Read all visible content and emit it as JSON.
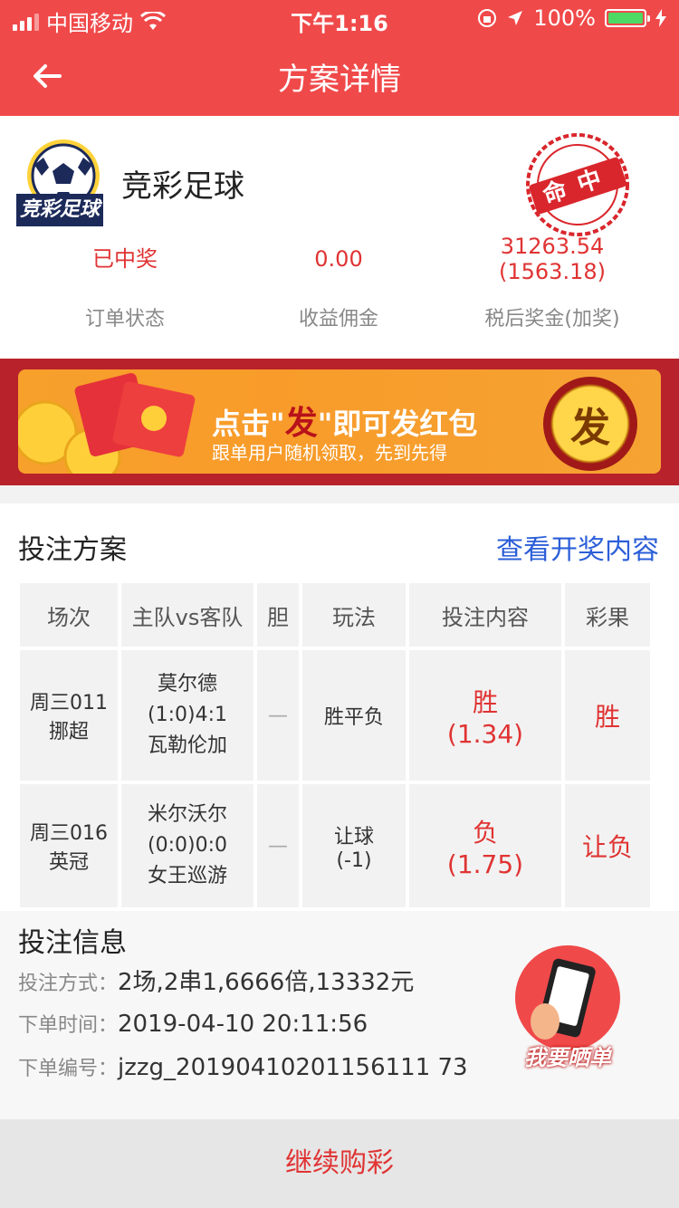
{
  "status_bar": {
    "carrier": "中国移动",
    "time": "下午1:16",
    "battery": "100%"
  },
  "nav": {
    "title": "方案详情"
  },
  "lottery": {
    "name": "竞彩足球",
    "logo_text": "竞彩足球",
    "stamp_text": "命中"
  },
  "stats": [
    {
      "value": "已中奖",
      "label": "订单状态"
    },
    {
      "value": "0.00",
      "label": "收益佣金"
    },
    {
      "value": "31263.54",
      "value2": "(1563.18)",
      "label": "税后奖金(加奖)"
    }
  ],
  "banner": {
    "prefix": "点击\"",
    "highlight": "发",
    "suffix": "\"即可发红包",
    "sub": "跟单用户随机领取，先到先得",
    "button": "发"
  },
  "plan": {
    "title": "投注方案",
    "link": "查看开奖内容",
    "headers": [
      "场次",
      "主队vs客队",
      "胆",
      "玩法",
      "投注内容",
      "彩果"
    ],
    "rows": [
      {
        "match_no": "周三011",
        "league": "挪超",
        "home": "莫尔德",
        "score": "(1:0)4:1",
        "away": "瓦勒伦加",
        "banker": "—",
        "play": "胜平负",
        "play2": "",
        "pick": "胜",
        "odds": "(1.34)",
        "result": "胜"
      },
      {
        "match_no": "周三016",
        "league": "英冠",
        "home": "米尔沃尔",
        "score": "(0:0)0:0",
        "away": "女王巡游",
        "banker": "—",
        "play": "让球",
        "play2": "(-1)",
        "pick": "负",
        "odds": "(1.75)",
        "result": "让负"
      }
    ]
  },
  "info": {
    "title": "投注信息",
    "method_label": "投注方式：",
    "method": "2场,2串1,6666倍,13332元",
    "time_label": "下单时间：",
    "time": "2019-04-10 20:11:56",
    "id_label": "下单编号：",
    "id": "jzzg_20190410201156111 73",
    "share_label": "我要晒单"
  },
  "bottom": {
    "button": "继续购彩"
  },
  "colors": {
    "brand_red": "#f0494a",
    "link_blue": "#2c5fd8",
    "win_red": "#e03333"
  }
}
